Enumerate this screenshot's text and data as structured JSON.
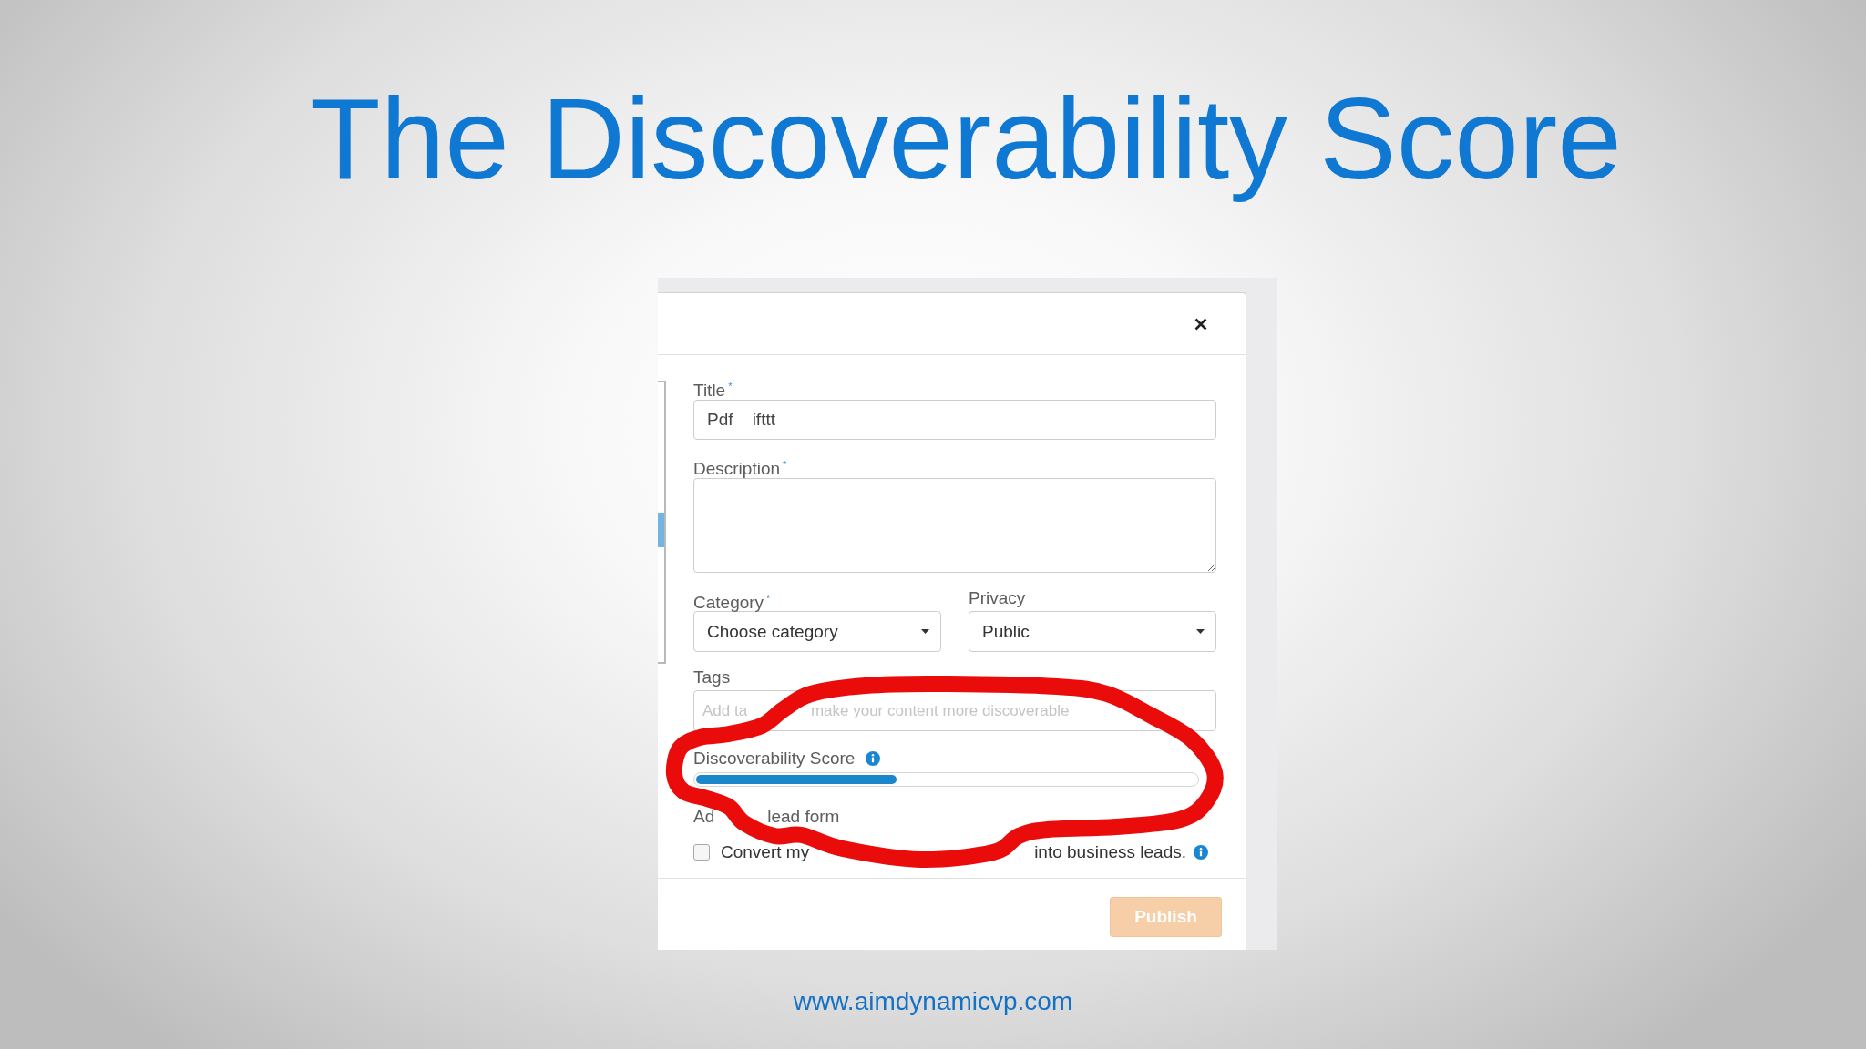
{
  "slide": {
    "title": "The Discoverability Score",
    "footer_url": "www.aimdynamicvp.com"
  },
  "dialog": {
    "title_field": {
      "label": "Title",
      "required_mark": "*",
      "value": "Pdf    ifttt"
    },
    "description_field": {
      "label": "Description",
      "required_mark": "*"
    },
    "category_field": {
      "label": "Category",
      "required_mark": "*",
      "value": "Choose category"
    },
    "privacy_field": {
      "label": "Privacy",
      "value": "Public"
    },
    "tags_field": {
      "label": "Tags",
      "placeholder_parts": [
        "Add ta",
        "make your content more discoverable"
      ]
    },
    "discoverability_score": {
      "label": "Discoverability Score",
      "level": 0.4
    },
    "lead_form": {
      "label_parts": [
        "Ad",
        "lead form"
      ],
      "checkbox": {
        "checked": false,
        "text_parts": [
          "Convert my",
          "into business leads."
        ]
      }
    },
    "publish_button": {
      "label": "Publish",
      "disabled": true
    }
  }
}
